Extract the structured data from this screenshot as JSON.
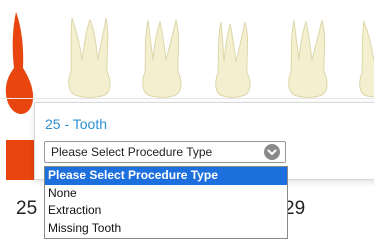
{
  "tooth_chart": {
    "numbers": {
      "left": "25",
      "right": "29"
    },
    "selected_color": "#e8450f",
    "tooth_color": "#f4f0cf"
  },
  "popup": {
    "title": "25 - Tooth",
    "select": {
      "value": "Please Select Procedure Type",
      "chevron_icon": "chevron-down-icon"
    }
  },
  "dropdown": {
    "options": [
      "Please Select Procedure Type",
      "None",
      "Extraction",
      "Missing Tooth"
    ],
    "selected_index": 0
  },
  "colors": {
    "title": "#2e8fd2",
    "highlight": "#1e6fde"
  }
}
